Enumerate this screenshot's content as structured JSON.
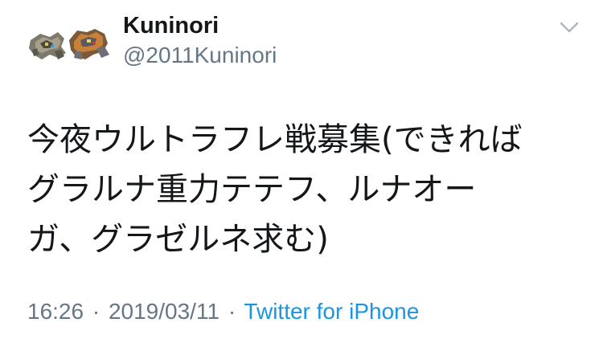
{
  "user": {
    "display_name": "Kuninori",
    "handle": "@2011Kuninori",
    "avatar_icon": "pokemon-sprites-avatar"
  },
  "tweet": {
    "lines": [
      "今夜ウルトラフレ戦募集(できれば",
      "グラルナ重力テテフ、ルナオー",
      "ガ、グラゼルネ求む)"
    ]
  },
  "meta": {
    "time": "16:26",
    "separator": "·",
    "date": "2019/03/11",
    "source": "Twitter for iPhone"
  },
  "menu": {
    "caret_icon": "chevron-down-icon"
  },
  "colors": {
    "text": "#14171a",
    "secondary": "#657786",
    "link": "#1b95e0"
  }
}
